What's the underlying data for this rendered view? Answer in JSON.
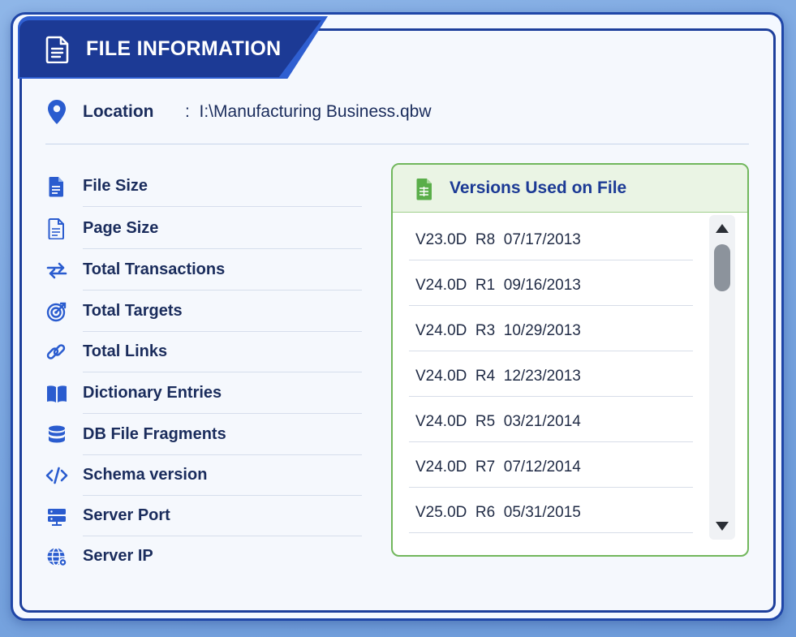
{
  "panel": {
    "title": "FILE INFORMATION",
    "title_icon": "document-icon"
  },
  "location": {
    "icon": "location-pin-icon",
    "label": "Location",
    "separator": ":",
    "value": "I:\\Manufacturing Business.qbw"
  },
  "stats": [
    {
      "label": "File Size",
      "icon": "file-icon"
    },
    {
      "label": "Page Size",
      "icon": "page-icon"
    },
    {
      "label": "Total Transactions",
      "icon": "transfer-arrows-icon"
    },
    {
      "label": "Total Targets",
      "icon": "target-icon"
    },
    {
      "label": "Total Links",
      "icon": "link-icon"
    },
    {
      "label": "Dictionary Entries",
      "icon": "book-icon"
    },
    {
      "label": "DB File Fragments",
      "icon": "database-icon"
    },
    {
      "label": "Schema version",
      "icon": "code-icon"
    },
    {
      "label": "Server Port",
      "icon": "server-icon"
    },
    {
      "label": "Server IP",
      "icon": "globe-icon"
    }
  ],
  "versions": {
    "title": "Versions Used on File",
    "icon": "spreadsheet-file-icon",
    "items": [
      "V23.0D  R8  07/17/2013",
      "V24.0D  R1  09/16/2013",
      "V24.0D  R3  10/29/2013",
      "V24.0D  R4  12/23/2013",
      "V24.0D  R5  03/21/2014",
      "V24.0D  R7  07/12/2014",
      "V25.0D  R6  05/31/2015"
    ]
  },
  "colors": {
    "brand_blue": "#1c3a95",
    "accent_green": "#71b75c",
    "text_dark": "#1a2c5c"
  }
}
